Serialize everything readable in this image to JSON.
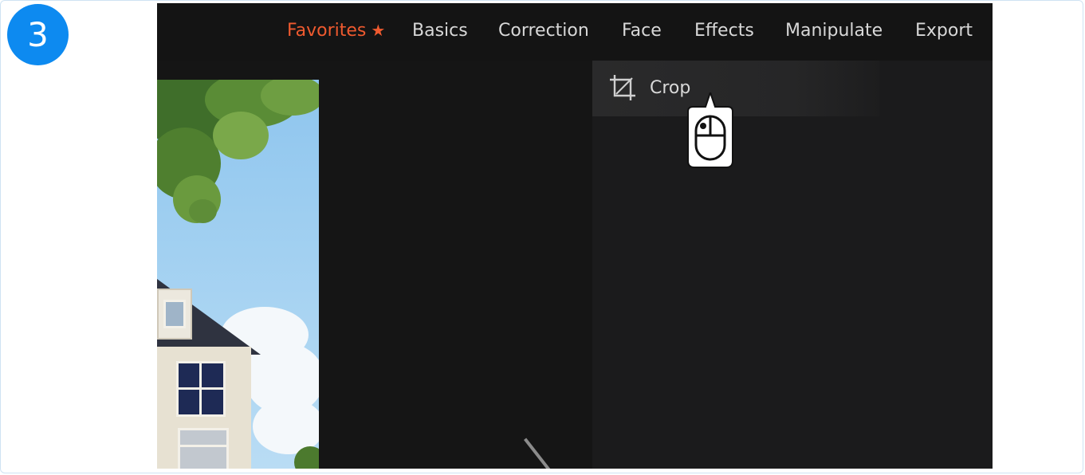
{
  "step": {
    "number": "3"
  },
  "menu": {
    "tabs": [
      {
        "label": "Favorites",
        "active": true
      },
      {
        "label": "Basics"
      },
      {
        "label": "Correction"
      },
      {
        "label": "Face"
      },
      {
        "label": "Effects"
      },
      {
        "label": "Manipulate"
      },
      {
        "label": "Export"
      }
    ],
    "favorites_star": "★"
  },
  "panel": {
    "items": [
      {
        "label": "Crop",
        "icon": "crop-icon"
      }
    ]
  },
  "colors": {
    "accent": "#ef5a2f",
    "badge": "#0d8af0",
    "app_bg": "#151515",
    "panel_bg": "#1b1b1c"
  }
}
